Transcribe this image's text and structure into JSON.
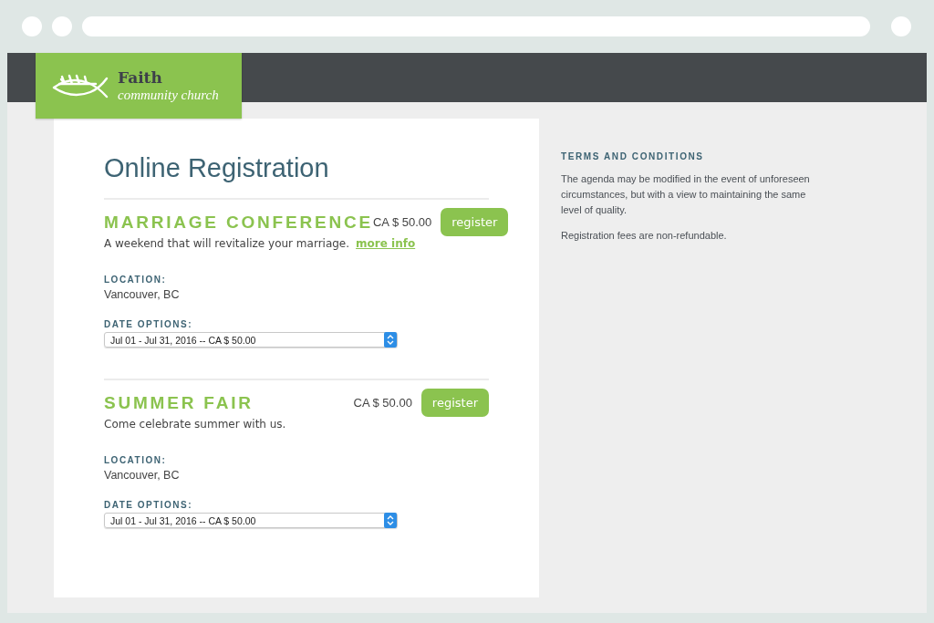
{
  "logo": {
    "name": "Faith",
    "tagline": "community church"
  },
  "page_title": "Online Registration",
  "events": [
    {
      "title": "MARRIAGE CONFERENCE",
      "price": "CA $ 50.00",
      "button": "register",
      "description": "A weekend that will revitalize your marriage.",
      "link": "more info",
      "location_label": "LOCATION:",
      "location": "Vancouver, BC",
      "date_label": "DATE OPTIONS:",
      "date_value": "Jul 01 - Jul 31, 2016 -- CA $ 50.00"
    },
    {
      "title": "SUMMER FAIR",
      "price": "CA $ 50.00",
      "button": "register",
      "description": "Come celebrate summer with us.",
      "location_label": "LOCATION:",
      "location": "Vancouver, BC",
      "date_label": "DATE OPTIONS:",
      "date_value": "Jul 01 - Jul 31, 2016 -- CA $ 50.00"
    }
  ],
  "terms": {
    "heading": "TERMS AND CONDITIONS",
    "paragraphs": [
      "The agenda may be modified in the event of unforeseen circumstances, but with a view to maintaining the same level of quality.",
      "Registration fees are non-refundable."
    ]
  }
}
